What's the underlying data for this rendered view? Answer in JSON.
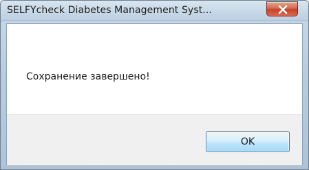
{
  "window": {
    "title": "SELFYcheck Diabetes Management Syst..."
  },
  "dialog": {
    "message": "Сохранение завершено!",
    "ok_label": "OK"
  },
  "icons": {
    "close": "close-icon"
  },
  "colors": {
    "titlebar": "#c7d8e7",
    "close_button": "#c84128",
    "client_background": "#ffffff",
    "footer_background": "#f0f0f0",
    "ok_button_border": "#3c7fb1"
  }
}
